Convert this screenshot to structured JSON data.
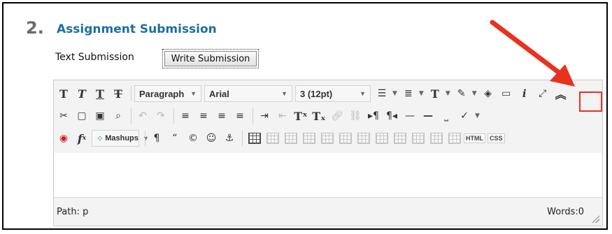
{
  "step": {
    "number": "2.",
    "title": "Assignment Submission"
  },
  "submission": {
    "label": "Text Submission",
    "button_label": "Write Submission"
  },
  "toolbar": {
    "format_block": "Paragraph",
    "font_family": "Arial",
    "font_size": "3 (12pt)",
    "html_label": "HTML",
    "css_label": "CSS",
    "mashups_label": "Mashups"
  },
  "status": {
    "path_label": "Path: p",
    "words_label": "Words:0"
  },
  "colors": {
    "title": "#1d6fa0",
    "highlight": "#e8321f"
  }
}
